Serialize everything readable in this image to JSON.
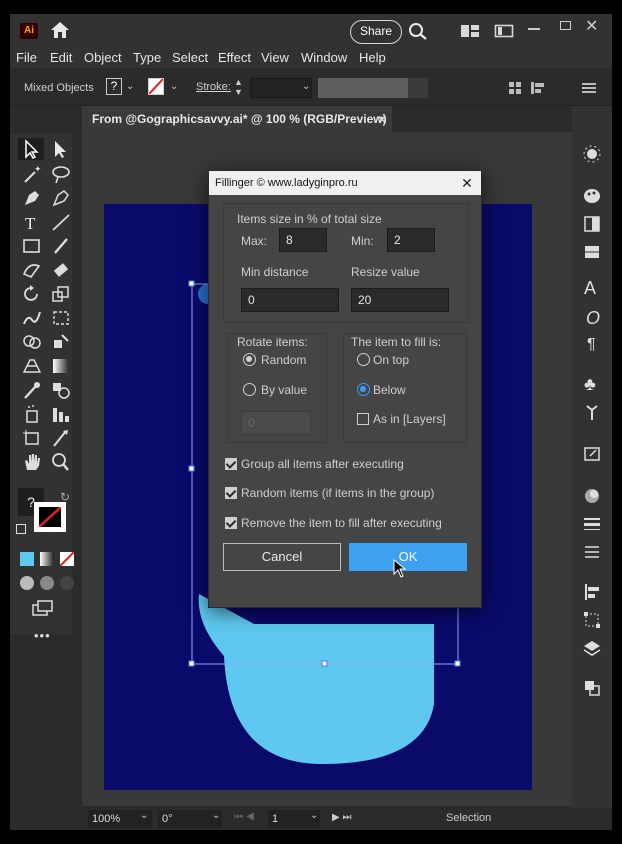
{
  "app": {
    "logo": "Ai"
  },
  "titlebar": {
    "share_label": "Share"
  },
  "menu": [
    "File",
    "Edit",
    "Object",
    "Type",
    "Select",
    "Effect",
    "View",
    "Window",
    "Help"
  ],
  "controlbar": {
    "selection_label": "Mixed Objects",
    "fill_label": "?",
    "stroke_label": "Stroke:"
  },
  "document": {
    "tab_title": "From @Gographicsavvy.ai* @ 100 % (RGB/Preview)",
    "close": "×"
  },
  "toolbar": {
    "fill_unknown": "?",
    "more": "•••"
  },
  "statusbar": {
    "zoom": "100%",
    "rotation": "0°",
    "artboard": "1",
    "mode": "Selection"
  },
  "dialog": {
    "title": "Fillinger © www.ladyginpro.ru",
    "close": "✕",
    "items_size_label": "Items size in % of total size",
    "max_label": "Max:",
    "max_value": "8",
    "min_label": "Min:",
    "min_value": "2",
    "min_distance_label": "Min distance",
    "min_distance_value": "0",
    "resize_label": "Resize value",
    "resize_value": "20",
    "rotate_label": "Rotate items:",
    "rotate_random": "Random",
    "rotate_by_value": "By value",
    "rotate_value": "0",
    "fill_label": "The item to fill is:",
    "fill_on_top": "On top",
    "fill_below": "Below",
    "fill_as_layers": "As in [Layers]",
    "check_group": "Group all items after executing",
    "check_random": "Random items (if items in the group)",
    "check_remove": "Remove the item to fill after executing",
    "cancel_label": "Cancel",
    "ok_label": "OK",
    "state": {
      "rotate": "Random",
      "fill": "Below",
      "as_layers": false,
      "group": true,
      "random_items": true,
      "remove": true
    }
  },
  "colors": {
    "artboard": "#0a0a6b",
    "shape": "#5ec8f0",
    "accent": "#3ea0f0"
  }
}
